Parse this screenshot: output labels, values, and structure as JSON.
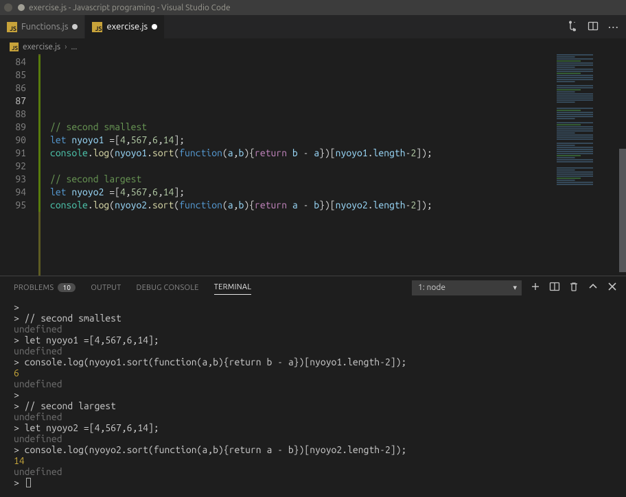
{
  "window": {
    "title": "exercise.js - Javascript programing - Visual Studio Code"
  },
  "tabs": [
    {
      "label": "Functions.js",
      "modified": true,
      "active": false
    },
    {
      "label": "exercise.js",
      "modified": true,
      "active": true
    }
  ],
  "breadcrumb": {
    "file": "exercise.js",
    "sep": "›",
    "more": "..."
  },
  "editor": {
    "line_start": 84,
    "current_line": 87,
    "lines": [
      {
        "n": 84,
        "tokens": []
      },
      {
        "n": 85,
        "tokens": []
      },
      {
        "n": 86,
        "tokens": []
      },
      {
        "n": 87,
        "tokens": []
      },
      {
        "n": 88,
        "tokens": []
      },
      {
        "n": 89,
        "tokens": [
          [
            "c-cm",
            "// second smallest"
          ]
        ]
      },
      {
        "n": 90,
        "tokens": [
          [
            "c-kw",
            "let"
          ],
          [
            "c-pl",
            " "
          ],
          [
            "c-var",
            "nyoyo1"
          ],
          [
            "c-pl",
            " =["
          ],
          [
            "c-num",
            "4"
          ],
          [
            "c-pl",
            ","
          ],
          [
            "c-num",
            "567"
          ],
          [
            "c-pl",
            ","
          ],
          [
            "c-num",
            "6"
          ],
          [
            "c-pl",
            ","
          ],
          [
            "c-num",
            "14"
          ],
          [
            "c-pl",
            "];"
          ]
        ]
      },
      {
        "n": 91,
        "tokens": [
          [
            "c-obj",
            "console"
          ],
          [
            "c-pl",
            "."
          ],
          [
            "c-fn",
            "log"
          ],
          [
            "c-pl",
            "("
          ],
          [
            "c-var",
            "nyoyo1"
          ],
          [
            "c-pl",
            "."
          ],
          [
            "c-fn",
            "sort"
          ],
          [
            "c-pl",
            "("
          ],
          [
            "c-kw",
            "function"
          ],
          [
            "c-pl",
            "("
          ],
          [
            "c-var",
            "a"
          ],
          [
            "c-pl",
            ","
          ],
          [
            "c-var",
            "b"
          ],
          [
            "c-pl",
            "){"
          ],
          [
            "c-ctrl",
            "return"
          ],
          [
            "c-pl",
            " "
          ],
          [
            "c-var",
            "b"
          ],
          [
            "c-pl",
            " - "
          ],
          [
            "c-var",
            "a"
          ],
          [
            "c-pl",
            "})["
          ],
          [
            "c-var",
            "nyoyo1"
          ],
          [
            "c-pl",
            "."
          ],
          [
            "c-var",
            "length"
          ],
          [
            "c-pl",
            "-"
          ],
          [
            "c-num",
            "2"
          ],
          [
            "c-pl",
            "]);"
          ]
        ]
      },
      {
        "n": 92,
        "tokens": []
      },
      {
        "n": 93,
        "tokens": [
          [
            "c-cm",
            "// second largest"
          ]
        ]
      },
      {
        "n": 94,
        "tokens": [
          [
            "c-kw",
            "let"
          ],
          [
            "c-pl",
            " "
          ],
          [
            "c-var",
            "nyoyo2"
          ],
          [
            "c-pl",
            " =["
          ],
          [
            "c-num",
            "4"
          ],
          [
            "c-pl",
            ","
          ],
          [
            "c-num",
            "567"
          ],
          [
            "c-pl",
            ","
          ],
          [
            "c-num",
            "6"
          ],
          [
            "c-pl",
            ","
          ],
          [
            "c-num",
            "14"
          ],
          [
            "c-pl",
            "];"
          ]
        ]
      },
      {
        "n": 95,
        "tokens": [
          [
            "c-obj",
            "console"
          ],
          [
            "c-pl",
            "."
          ],
          [
            "c-fn",
            "log"
          ],
          [
            "c-pl",
            "("
          ],
          [
            "c-var",
            "nyoyo2"
          ],
          [
            "c-pl",
            "."
          ],
          [
            "c-fn",
            "sort"
          ],
          [
            "c-pl",
            "("
          ],
          [
            "c-kw",
            "function"
          ],
          [
            "c-pl",
            "("
          ],
          [
            "c-var",
            "a"
          ],
          [
            "c-pl",
            ","
          ],
          [
            "c-var",
            "b"
          ],
          [
            "c-pl",
            "){"
          ],
          [
            "c-ctrl",
            "return"
          ],
          [
            "c-pl",
            " "
          ],
          [
            "c-var",
            "a"
          ],
          [
            "c-pl",
            " - "
          ],
          [
            "c-var",
            "b"
          ],
          [
            "c-pl",
            "})["
          ],
          [
            "c-var",
            "nyoyo2"
          ],
          [
            "c-pl",
            "."
          ],
          [
            "c-var",
            "length"
          ],
          [
            "c-pl",
            "-"
          ],
          [
            "c-num",
            "2"
          ],
          [
            "c-pl",
            "]);"
          ]
        ]
      }
    ]
  },
  "panel": {
    "tabs": {
      "problems": "PROBLEMS",
      "problems_count": "10",
      "output": "OUTPUT",
      "debug": "DEBUG CONSOLE",
      "terminal": "TERMINAL"
    },
    "dropdown": "1: node",
    "terminal_lines": [
      {
        "cls": "",
        "text": "> "
      },
      {
        "cls": "",
        "text": "> // second smallest"
      },
      {
        "cls": "t-undef",
        "text": "undefined"
      },
      {
        "cls": "",
        "text": "> let nyoyo1 =[4,567,6,14];"
      },
      {
        "cls": "t-undef",
        "text": "undefined"
      },
      {
        "cls": "",
        "text": "> console.log(nyoyo1.sort(function(a,b){return b - a})[nyoyo1.length-2]);"
      },
      {
        "cls": "t-res",
        "text": "6"
      },
      {
        "cls": "t-undef",
        "text": "undefined"
      },
      {
        "cls": "",
        "text": "> "
      },
      {
        "cls": "",
        "text": "> // second largest"
      },
      {
        "cls": "t-undef",
        "text": "undefined"
      },
      {
        "cls": "",
        "text": "> let nyoyo2 =[4,567,6,14];"
      },
      {
        "cls": "t-undef",
        "text": "undefined"
      },
      {
        "cls": "",
        "text": "> console.log(nyoyo2.sort(function(a,b){return a - b})[nyoyo2.length-2]);"
      },
      {
        "cls": "t-res",
        "text": "14"
      },
      {
        "cls": "t-undef",
        "text": "undefined"
      }
    ],
    "prompt": "> "
  }
}
